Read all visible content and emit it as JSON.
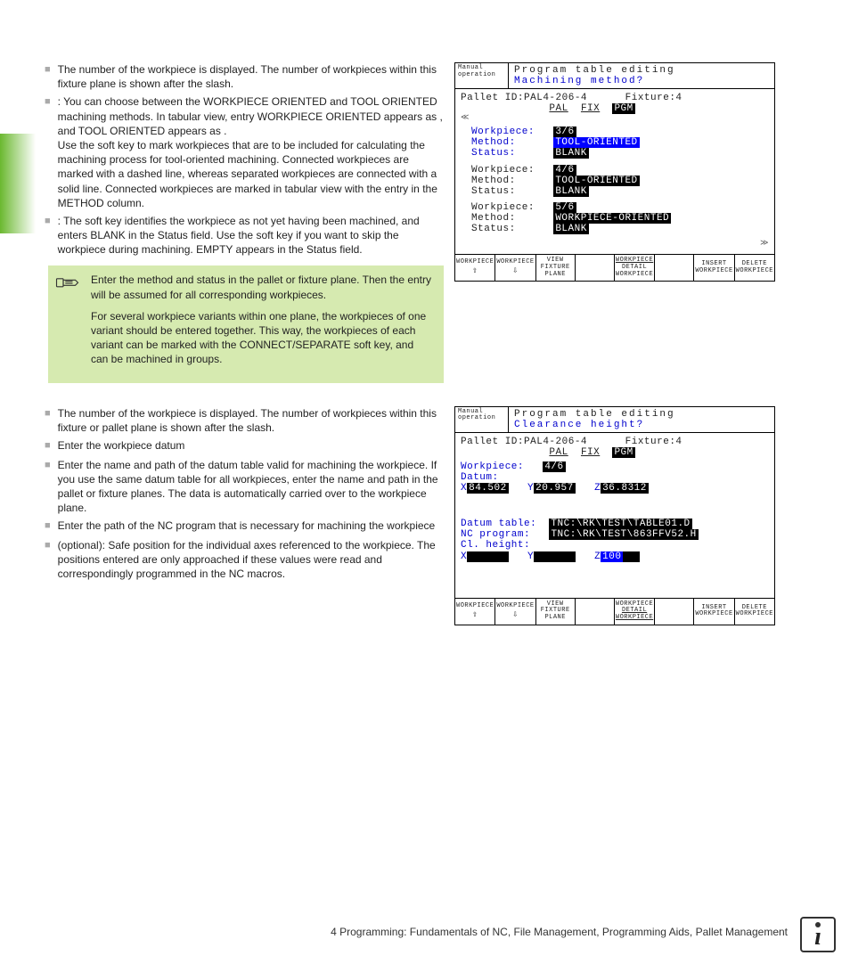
{
  "sidebar": {},
  "text1": {
    "b1": "The number of the workpiece is displayed. The number of workpieces within this fixture plane is shown after the slash.",
    "b2": ": You can choose between the WORKPIECE ORIENTED and TOOL ORIENTED machining methods. In tabular view, entry WORKPIECE ORIENTED appears as      , and TOOL ORIENTED appears as      .",
    "b2b": "Use the                                         soft key to mark workpieces that are to be included for calculating the machining process for tool-oriented machining. Connected workpieces are marked with a dashed line, whereas separated workpieces are connected with a solid line. Connected workpieces are marked in tabular view with the entry       in the METHOD column.",
    "b3a": ": The soft key                     identifies the workpiece as not yet having been machined, and enters BLANK in the Status field. Use the soft key                                    if you want to skip the workpiece during machining. EMPTY appears in the Status field."
  },
  "note": {
    "p1": "Enter the method and status in the pallet or fixture plane. Then the entry will be assumed for all corresponding workpieces.",
    "p2": "For several workpiece variants within one plane, the workpieces of one variant should be entered together. This way, the workpieces of each variant can be marked with the CONNECT/SEPARATE soft key, and can be machined in groups."
  },
  "text2": {
    "b1": "The number of the workpiece is displayed. The number of workpieces within this fixture or pallet plane is shown after the slash.",
    "b2": "Enter the workpiece datum",
    "b3": "Enter the name and path of the datum table valid for machining the workpiece. If you use the same datum table for all workpieces, enter the name and path in the pallet or fixture planes. The data is automatically carried over to the workpiece plane.",
    "b4": "Enter the path of the NC program that is necessary for machining the workpiece",
    "b5": "(optional): Safe position for the individual axes referenced to the workpiece. The positions entered are only approached if these values were read and correspondingly programmed in the NC macros."
  },
  "cnc1": {
    "mode": "Manual operation",
    "title1": "Program table editing",
    "title2": "Machining method?",
    "header": "Pallet ID:PAL4-206-4      Fixture:4",
    "tabs": {
      "pal": "PAL",
      "fix": "FIX",
      "pgm": "PGM"
    },
    "rows": [
      {
        "wp": "3/6",
        "method": "TOOL-ORIENTED",
        "status": "BLANK",
        "highlight": true
      },
      {
        "wp": "4/6",
        "method": "TOOL-ORIENTED",
        "status": "BLANK"
      },
      {
        "wp": "5/6",
        "method": "WORKPIECE-ORIENTED",
        "status": "BLANK"
      }
    ],
    "labels": {
      "wp": "Workpiece:",
      "method": "Method:",
      "status": "Status:"
    }
  },
  "softkeys": {
    "k1": "WORKPIECE",
    "k1b": "⇧",
    "k2": "WORKPIECE",
    "k2b": "⇩",
    "k3a": "VIEW",
    "k3b": "FIXTURE",
    "k3c": "PLANE",
    "k5a": "WORKPIECE",
    "k5b": "DETAIL",
    "k5c": "WORKPIECE",
    "k7a": "INSERT",
    "k7b": "WORKPIECE",
    "k8a": "DELETE",
    "k8b": "WORKPIECE"
  },
  "cnc2": {
    "mode": "Manual operation",
    "title1": "Program table editing",
    "title2": "Clearance height?",
    "header": "Pallet ID:PAL4-206-4      Fixture:4",
    "tabs": {
      "pal": "PAL",
      "fix": "FIX",
      "pgm": "PGM"
    },
    "wp_label": "Workpiece:",
    "wp_value": "4/6",
    "datum_label": "Datum:",
    "x_label": "X",
    "x_val": "84.502",
    "y_label": "Y",
    "y_val": "20.957",
    "z_label": "Z",
    "z_val": "36.8312",
    "dtable_label": "Datum table:",
    "dtable_val": "TNC:\\RK\\TEST\\TABLE01.D",
    "ncprog_label": "NC program:",
    "ncprog_val": "TNC:\\RK\\TEST\\863FFV52.H",
    "cl_label": "Cl. height:",
    "cx_label": "X",
    "cy_label": "Y",
    "cz_label": "Z",
    "cz_val": "100"
  },
  "footer": "4 Programming: Fundamentals of NC, File Management, Programming Aids, Pallet Management"
}
